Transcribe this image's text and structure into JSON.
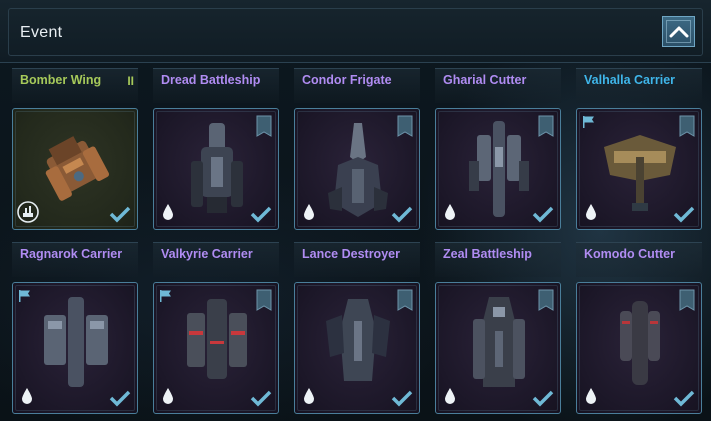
{
  "header": {
    "title": "Event",
    "collapse_icon": "chevron-up-icon"
  },
  "colors": {
    "rarity_uncommon": "#a6c95a",
    "rarity_epic": "#b08cf2",
    "rarity_rare": "#3fb6ea",
    "card_border": "#4a7e9a",
    "check": "#6fb9d6"
  },
  "ships": [
    {
      "name": "Bomber Wing",
      "rank": "II",
      "rarity": "uncommon",
      "selected": true
    },
    {
      "name": "Dread Battleship",
      "rarity": "epic",
      "selected": true
    },
    {
      "name": "Condor Frigate",
      "rarity": "epic",
      "selected": true
    },
    {
      "name": "Gharial Cutter",
      "rarity": "epic",
      "selected": true
    },
    {
      "name": "Valhalla Carrier",
      "rarity": "rare",
      "selected": true
    },
    {
      "name": "Ragnarok Carrier",
      "rarity": "epic",
      "selected": true
    },
    {
      "name": "Valkyrie Carrier",
      "rarity": "epic",
      "selected": true
    },
    {
      "name": "Lance Destroyer",
      "rarity": "epic",
      "selected": true
    },
    {
      "name": "Zeal Battleship",
      "rarity": "epic",
      "selected": true
    },
    {
      "name": "Komodo Cutter",
      "rarity": "epic",
      "selected": true
    }
  ]
}
